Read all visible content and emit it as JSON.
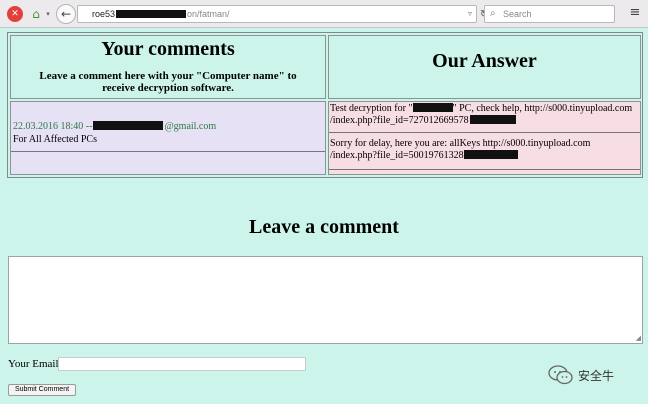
{
  "browser": {
    "url_prefix": "roe53",
    "url_suffix": "on/fatman/",
    "search_placeholder": "Search"
  },
  "comments_table": {
    "left_header": "Your comments",
    "left_note": "Leave a comment here with your \"Computer name\" to receive decryption software.",
    "right_header": "Our Answer",
    "comment": {
      "date_prefix": "22.03.2016 18:40 --",
      "email_suffix": "@gmail.com",
      "text": "For All Affected PCs"
    },
    "answers": [
      {
        "text_a": "Test decryption for \"",
        "text_b": "\" PC, check help, http://s000.tinyupload.com /index.php?file_id=727012669578"
      },
      {
        "text_a": "Sorry for delay, here you are: allKeys http://s000.tinyupload.com /index.php?file_id=50019761328",
        "text_b": ""
      }
    ]
  },
  "form": {
    "title": "Leave a comment",
    "email_label": "Your Email:",
    "submit_label": "Submit Comment"
  },
  "watermark": {
    "text": "安全牛"
  },
  "colors": {
    "page_bg": "#ccf4ea",
    "comment_cell_bg": "#e6e1f5",
    "answer_cell_bg": "#f7dde4",
    "date_text": "#2c7a40"
  }
}
